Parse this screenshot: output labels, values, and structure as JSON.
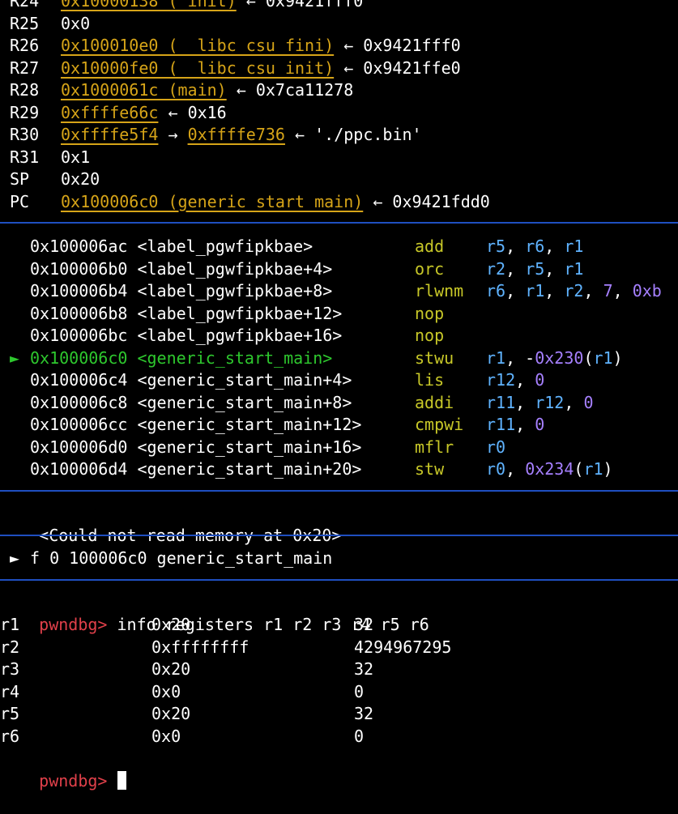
{
  "registers": [
    {
      "name": "R24",
      "value": "0x10000138 (_init)",
      "arrow": "←",
      "target": "0x9421fff0"
    },
    {
      "name": "R25",
      "value": "0x0"
    },
    {
      "name": "R26",
      "value": "0x100010e0 (__libc_csu_fini)",
      "arrow": "←",
      "target": "0x9421fff0"
    },
    {
      "name": "R27",
      "value": "0x10000fe0 (__libc_csu_init)",
      "arrow": "←",
      "target": "0x9421ffe0"
    },
    {
      "name": "R28",
      "value": "0x1000061c (main)",
      "arrow": "←",
      "target": "0x7ca11278"
    },
    {
      "name": "R29",
      "value": "0xffffe66c",
      "arrow": "←",
      "target": "0x16"
    },
    {
      "name": "R30",
      "value": "0xffffe5f4",
      "arrow": "→",
      "target": "0xffffe736",
      "arrow2": "←",
      "target2": "'./ppc.bin'"
    },
    {
      "name": "R31",
      "value": "0x1"
    },
    {
      "name": "SP",
      "value": "0x20"
    },
    {
      "name": "PC",
      "value": "0x100006c0 (generic_start_main)",
      "arrow": "←",
      "target": "0x9421fdd0"
    }
  ],
  "disasm": [
    {
      "marker": "",
      "addr": "0x100006ac",
      "label": "<label_pgwfipkbae>",
      "mnem": "add",
      "ops": [
        [
          "r5",
          "reg"
        ],
        [
          ", ",
          "p"
        ],
        [
          "r6",
          "reg"
        ],
        [
          ", ",
          "p"
        ],
        [
          "r1",
          "reg"
        ]
      ]
    },
    {
      "marker": "",
      "addr": "0x100006b0",
      "label": "<label_pgwfipkbae+4>",
      "mnem": "orc",
      "ops": [
        [
          "r2",
          "reg"
        ],
        [
          ", ",
          "p"
        ],
        [
          "r5",
          "reg"
        ],
        [
          ", ",
          "p"
        ],
        [
          "r1",
          "reg"
        ]
      ]
    },
    {
      "marker": "",
      "addr": "0x100006b4",
      "label": "<label_pgwfipkbae+8>",
      "mnem": "rlwnm",
      "ops": [
        [
          "r6",
          "reg"
        ],
        [
          ", ",
          "p"
        ],
        [
          "r1",
          "reg"
        ],
        [
          ", ",
          "p"
        ],
        [
          "r2",
          "reg"
        ],
        [
          ", ",
          "p"
        ],
        [
          "7",
          "num"
        ],
        [
          ", ",
          "p"
        ],
        [
          "0xb",
          "num"
        ]
      ]
    },
    {
      "marker": "",
      "addr": "0x100006b8",
      "label": "<label_pgwfipkbae+12>",
      "mnem": "nop",
      "ops": []
    },
    {
      "marker": "",
      "addr": "0x100006bc",
      "label": "<label_pgwfipkbae+16>",
      "mnem": "nop",
      "ops": []
    },
    {
      "marker": "►",
      "addr": "0x100006c0",
      "label": "<generic_start_main>",
      "mnem": "stwu",
      "current": true,
      "ops": [
        [
          "r1",
          "reg"
        ],
        [
          ", -",
          "p"
        ],
        [
          "0x230",
          "num"
        ],
        [
          "(",
          "p"
        ],
        [
          "r1",
          "reg"
        ],
        [
          ")",
          "p"
        ]
      ]
    },
    {
      "marker": "",
      "addr": "0x100006c4",
      "label": "<generic_start_main+4>",
      "mnem": "lis",
      "ops": [
        [
          "r12",
          "reg"
        ],
        [
          ", ",
          "p"
        ],
        [
          "0",
          "num"
        ]
      ]
    },
    {
      "marker": "",
      "addr": "0x100006c8",
      "label": "<generic_start_main+8>",
      "mnem": "addi",
      "ops": [
        [
          "r11",
          "reg"
        ],
        [
          ", ",
          "p"
        ],
        [
          "r12",
          "reg"
        ],
        [
          ", ",
          "p"
        ],
        [
          "0",
          "num"
        ]
      ]
    },
    {
      "marker": "",
      "addr": "0x100006cc",
      "label": "<generic_start_main+12>",
      "mnem": "cmpwi",
      "ops": [
        [
          "r11",
          "reg"
        ],
        [
          ", ",
          "p"
        ],
        [
          "0",
          "num"
        ]
      ]
    },
    {
      "marker": "",
      "addr": "0x100006d0",
      "label": "<generic_start_main+16>",
      "mnem": "mflr",
      "ops": [
        [
          "r0",
          "reg"
        ]
      ]
    },
    {
      "marker": "",
      "addr": "0x100006d4",
      "label": "<generic_start_main+20>",
      "mnem": "stw",
      "ops": [
        [
          "r0",
          "reg"
        ],
        [
          ", ",
          "p"
        ],
        [
          "0x234",
          "num"
        ],
        [
          "(",
          "p"
        ],
        [
          "r1",
          "reg"
        ],
        [
          ")",
          "p"
        ]
      ]
    }
  ],
  "stack_message": "<Could not read memory at 0x20>",
  "backtrace": {
    "marker": "►",
    "text": "f 0 100006c0 generic_start_main"
  },
  "prompt": "pwndbg>",
  "command": "info registers r1 r2 r3 r4 r5 r6",
  "info_regs": [
    {
      "name": "r1",
      "hex": "0x20",
      "dec": "32"
    },
    {
      "name": "r2",
      "hex": "0xffffffff",
      "dec": "4294967295"
    },
    {
      "name": "r3",
      "hex": "0x20",
      "dec": "32"
    },
    {
      "name": "r4",
      "hex": "0x0",
      "dec": "0"
    },
    {
      "name": "r5",
      "hex": "0x20",
      "dec": "32"
    },
    {
      "name": "r6",
      "hex": "0x0",
      "dec": "0"
    }
  ],
  "colors": {
    "background": "#000000",
    "separator": "#1f4fc0",
    "address": "#d6a418",
    "current": "#2ec82e",
    "mnemonic": "#c8c828",
    "register": "#5fb3ff",
    "number": "#a680ff",
    "prompt": "#e0404a"
  }
}
